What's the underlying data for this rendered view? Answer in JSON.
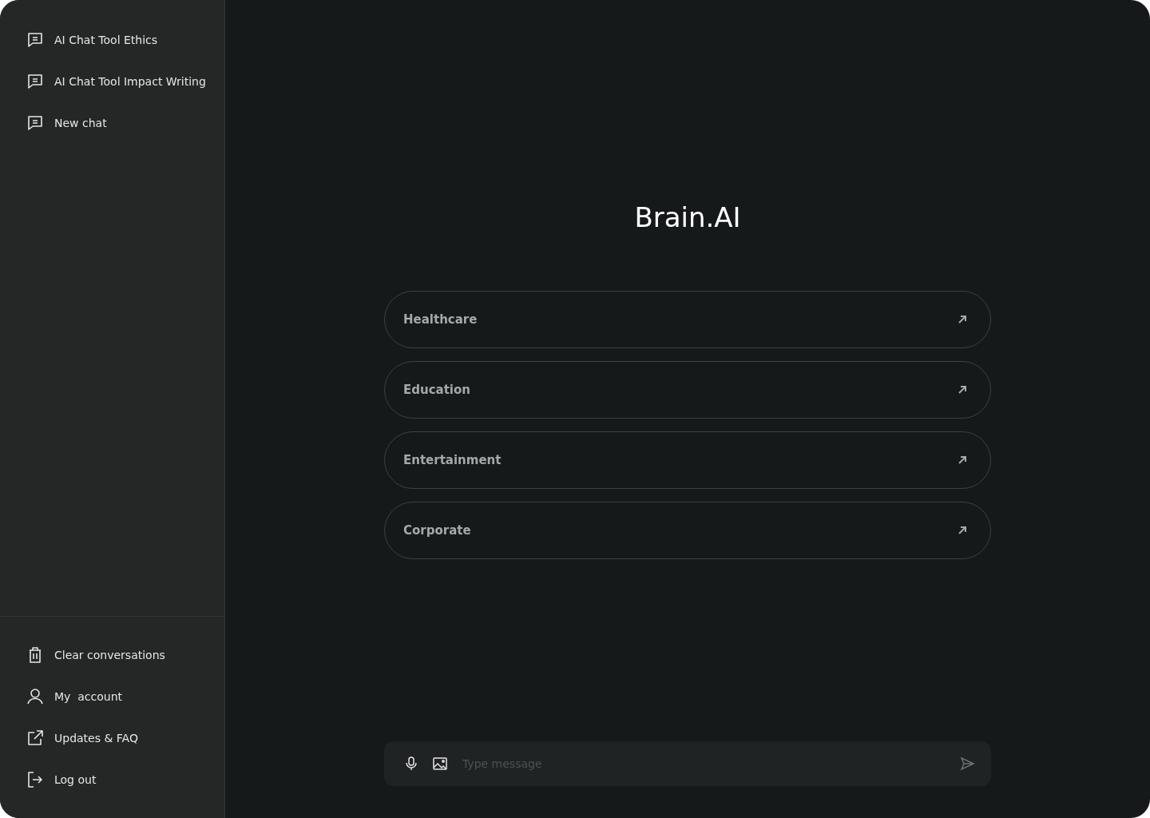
{
  "sidebar": {
    "chats": [
      {
        "label": "AI Chat Tool Ethics",
        "kind": "chat"
      },
      {
        "label": "AI Chat Tool Impact Writing",
        "kind": "chat"
      },
      {
        "label": "New chat",
        "kind": "chat"
      }
    ],
    "footer_items": [
      {
        "label": "Clear conversations",
        "kind": "trash"
      },
      {
        "label": "My  account",
        "kind": "user"
      },
      {
        "label": "Updates & FAQ",
        "kind": "external"
      },
      {
        "label": "Log out",
        "kind": "logout"
      }
    ]
  },
  "main": {
    "title": "Brain.AI",
    "suggestions": [
      {
        "label": "Healthcare"
      },
      {
        "label": "Education"
      },
      {
        "label": "Entertainment"
      },
      {
        "label": "Corporate"
      }
    ],
    "composer": {
      "placeholder": "Type message"
    }
  }
}
